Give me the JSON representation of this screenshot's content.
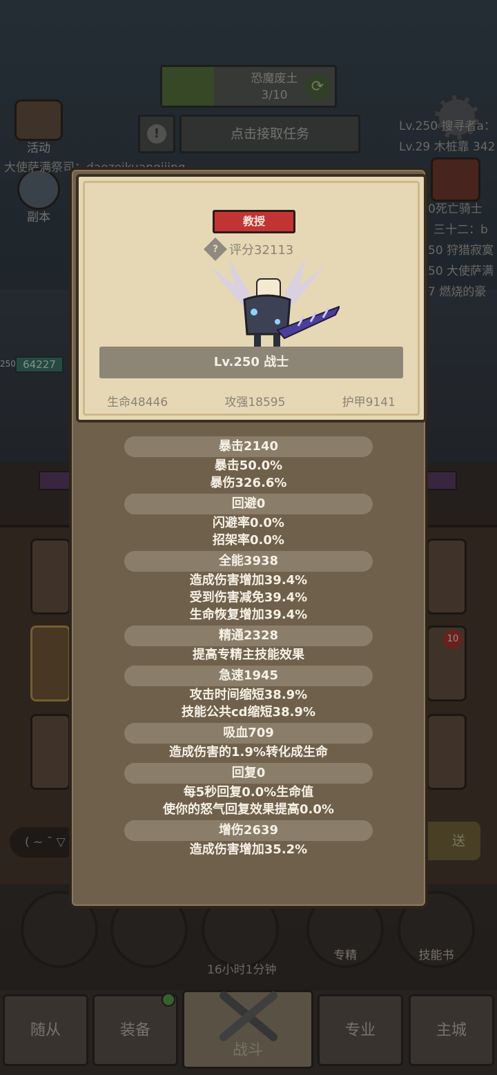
{
  "background": {
    "mission": {
      "title": "恐魔废土",
      "progress": "3/10",
      "progress_fraction": 0.3
    },
    "task_button": "点击接取任务",
    "side_buttons": {
      "activity": "活动",
      "dungeon": "副本"
    },
    "chat_left": "大使萨满祭司：daozeikuangjiing",
    "chat_right": [
      "Lv.250 搜寻者a：",
      "Lv.29 木桩靠 342",
      "0死亡骑士",
      "三十二：b",
      "50 狩猎寂寞",
      "50 大使萨满",
      "7 燃烧的豪"
    ],
    "hud": {
      "level": "250",
      "hp": "64227"
    },
    "chat_input": "( ~ ¯ ▽",
    "send_button": "送",
    "circle_buttons": {
      "specialize": "专精",
      "skill_book": "技能书"
    },
    "chest_timer": "16小时1分钟",
    "tabs": [
      "随从",
      "装备",
      "战斗",
      "专业",
      "主城"
    ],
    "badge_count": "10"
  },
  "panel": {
    "title_badge": "教授",
    "score": "评分32113",
    "level_class": "Lv.250 战士",
    "base_stats": [
      "生命48446",
      "攻强18595",
      "护甲9141"
    ],
    "attributes": [
      {
        "header": "暴击2140",
        "lines": [
          "暴击50.0%",
          "暴伤326.6%"
        ]
      },
      {
        "header": "回避0",
        "lines": [
          "闪避率0.0%",
          "招架率0.0%"
        ]
      },
      {
        "header": "全能3938",
        "lines": [
          "造成伤害增加39.4%",
          "受到伤害减免39.4%",
          "生命恢复增加39.4%"
        ]
      },
      {
        "header": "精通2328",
        "lines": [
          "提高专精主技能效果"
        ]
      },
      {
        "header": "急速1945",
        "lines": [
          "攻击时间缩短38.9%",
          "技能公共cd缩短38.9%"
        ]
      },
      {
        "header": "吸血709",
        "lines": [
          "造成伤害的1.9%转化成生命"
        ]
      },
      {
        "header": "回复0",
        "lines": [
          "每5秒回复0.0%生命值",
          "使你的怒气回复效果提高0.0%"
        ]
      },
      {
        "header": "增伤2639",
        "lines": [
          "造成伤害增加35.2%"
        ]
      }
    ]
  },
  "colors": {
    "title_badge": "#c23434",
    "card_bg": "#e6d8b5",
    "panel_bg": "#6f604b",
    "attr_header_bg": "#8a7e6a"
  }
}
